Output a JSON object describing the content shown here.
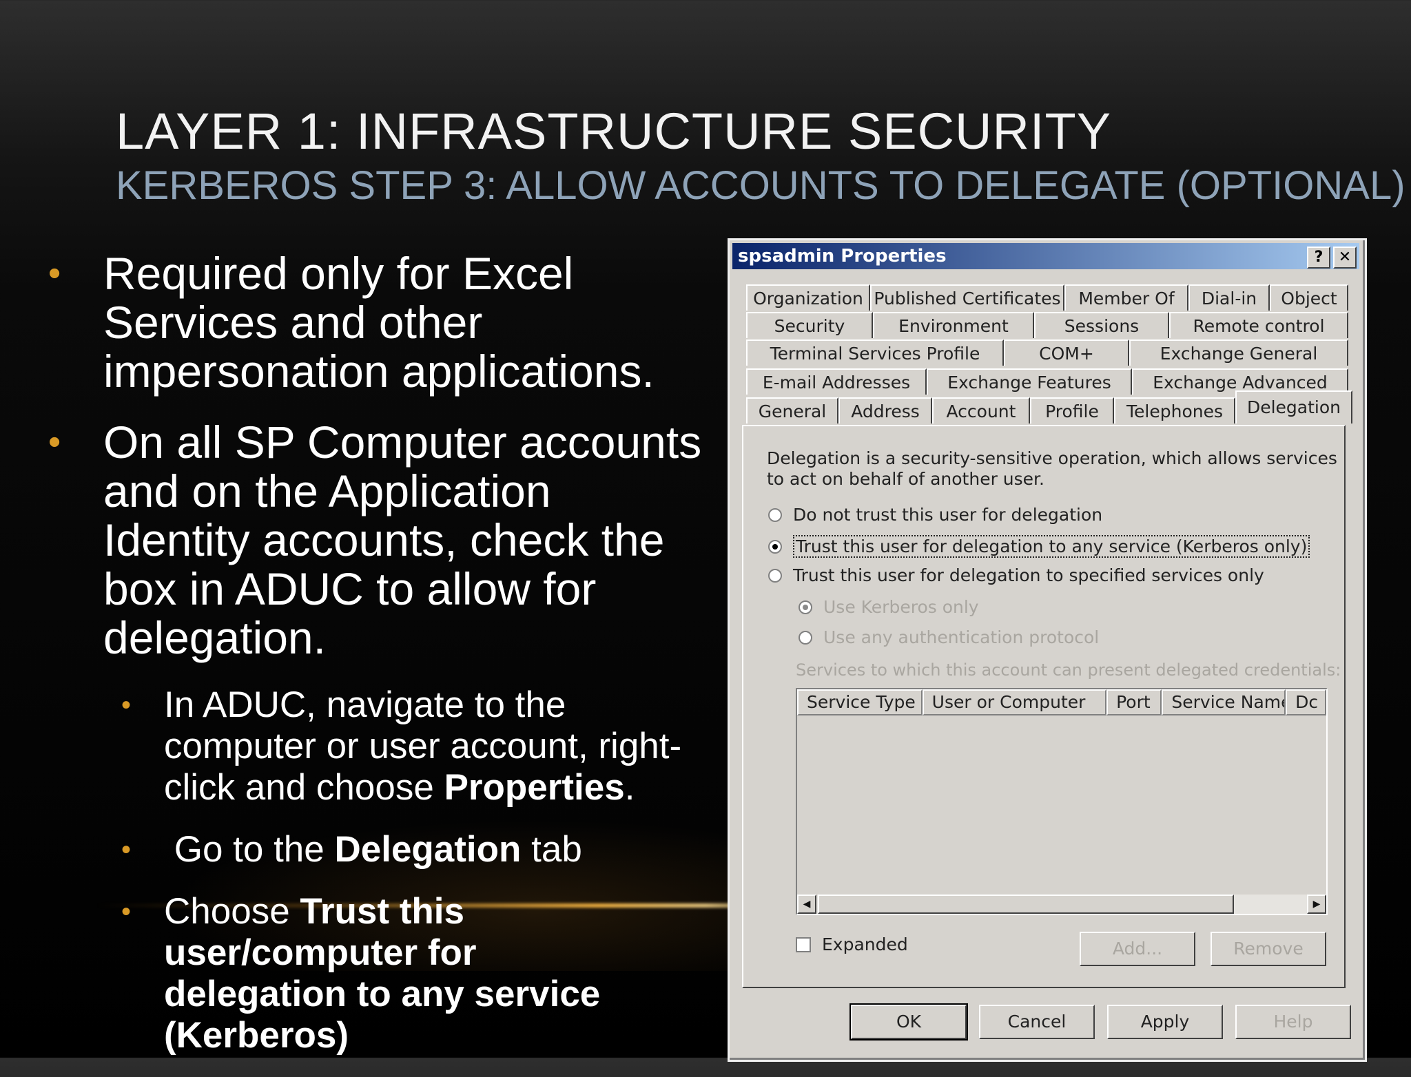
{
  "slide": {
    "title": "LAYER 1: INFRASTRUCTURE SECURITY",
    "subtitle": "KERBEROS STEP 3: ALLOW ACCOUNTS TO DELEGATE (OPTIONAL)",
    "bullets": [
      {
        "text": "Required only for Excel Services and other impersonation applications."
      },
      {
        "text": "On all SP Computer accounts and on the Application Identity accounts, check the box in ADUC to allow for delegation."
      }
    ],
    "subbullets": [
      {
        "pre": "In ADUC, navigate to the computer or user account, right-click and choose ",
        "bold": "Properties",
        "post": "."
      },
      {
        "pre": " Go to the ",
        "bold": "Delegation",
        "post": " tab"
      },
      {
        "pre": "Choose ",
        "bold": "Trust this user/computer for delegation to any service (Kerberos)",
        "post": ""
      }
    ],
    "bullet_color": "#d99a26"
  },
  "dialog": {
    "title": "spsadmin Properties",
    "help_btn": "?",
    "close_btn": "✕",
    "tabs_row1": [
      "Organization",
      "Published Certificates",
      "Member Of",
      "Dial-in",
      "Object"
    ],
    "tabs_row2": [
      "Security",
      "Environment",
      "Sessions",
      "Remote control"
    ],
    "tabs_row3": [
      "Terminal Services Profile",
      "COM+",
      "Exchange General"
    ],
    "tabs_row4": [
      "E-mail Addresses",
      "Exchange Features",
      "Exchange Advanced"
    ],
    "tabs_row5": [
      "General",
      "Address",
      "Account",
      "Profile",
      "Telephones",
      "Delegation"
    ],
    "description": "Delegation is a security-sensitive operation, which allows services to act on behalf of another user.",
    "options": {
      "no_trust": "Do not trust this user for delegation",
      "trust_any": "Trust this user for delegation to any service (Kerberos only)",
      "trust_specified": "Trust this user for delegation to specified services only",
      "kerberos_only": "Use Kerberos only",
      "any_protocol": "Use any authentication protocol"
    },
    "services_label": "Services to which this account can present delegated credentials:",
    "columns": [
      "Service Type",
      "User or Computer",
      "Port",
      "Service Name",
      "Dc"
    ],
    "expanded_label": "Expanded",
    "add_btn": "Add...",
    "remove_btn": "Remove",
    "ok_btn": "OK",
    "cancel_btn": "Cancel",
    "apply_btn": "Apply",
    "help_btn_label": "Help"
  }
}
